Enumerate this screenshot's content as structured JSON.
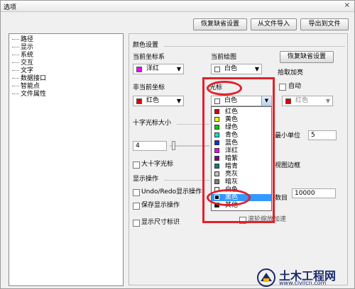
{
  "window": {
    "title": "选项",
    "close_glyph": "×"
  },
  "top_buttons": {
    "restore_defaults": "恢复缺省设置",
    "import_file": "从文件导入",
    "export_file": "导出到文件"
  },
  "tree_items": [
    "路径",
    "显示",
    "系统",
    "交互",
    "文字",
    "数据接口",
    "智能点",
    "文件属性"
  ],
  "color_settings": {
    "group_title": "颜色设置",
    "current_coord_label": "当前坐标系",
    "current_coord_value": "洋红",
    "current_coord_color": "#ff00ff",
    "current_draw_label": "当前绘图",
    "current_draw_value": "白色",
    "current_draw_color": "#ffffff",
    "restore_button": "恢复缺省设置",
    "non_current_label": "非当前坐标",
    "non_current_value": "红色",
    "non_current_color": "#e00000",
    "cursor_label": "光标",
    "cursor_value": "白色",
    "cursor_color": "#ffffff",
    "pick_highlight_label": "拾取加亮",
    "auto_label": "自动",
    "pick_value": "红色",
    "pick_color": "#e00000"
  },
  "crosshair": {
    "title": "十字光标大小",
    "size_value": "4",
    "large_crosshair_label": "大十字光标",
    "min_unit_label_partial": "最小单位",
    "min_unit_value": "5",
    "border_label_partial": "视图边框"
  },
  "display_ops": {
    "title": "显示操作",
    "undo_redo_label": "Undo/Redo显示操作",
    "save_display_label": "保存显示操作",
    "count_label_partial": "数目",
    "count_value": "10000",
    "show_dims_label": "显示尺寸标识",
    "wheel_zoom_partial": "滚轮缩放加速"
  },
  "dropdown_items": [
    {
      "label": "红色",
      "color": "#e00000"
    },
    {
      "label": "黄色",
      "color": "#ffff00"
    },
    {
      "label": "绿色",
      "color": "#00d000"
    },
    {
      "label": "青色",
      "color": "#00e0e0"
    },
    {
      "label": "蓝色",
      "color": "#1030e0"
    },
    {
      "label": "洋红",
      "color": "#ff00ff"
    },
    {
      "label": "暗紫",
      "color": "#800080"
    },
    {
      "label": "暗青",
      "color": "#008080"
    },
    {
      "label": "亮灰",
      "color": "#c0c0c0"
    },
    {
      "label": "暗灰",
      "color": "#808080"
    },
    {
      "label": "白色",
      "color": "#ffffff"
    },
    {
      "label": "黑色",
      "color": "#000000"
    },
    {
      "label": "其他",
      "color": "#000000"
    }
  ],
  "dropdown_selected_index": 11,
  "watermark": {
    "brand": "土木工程网",
    "url": "www.civilcn.com"
  }
}
